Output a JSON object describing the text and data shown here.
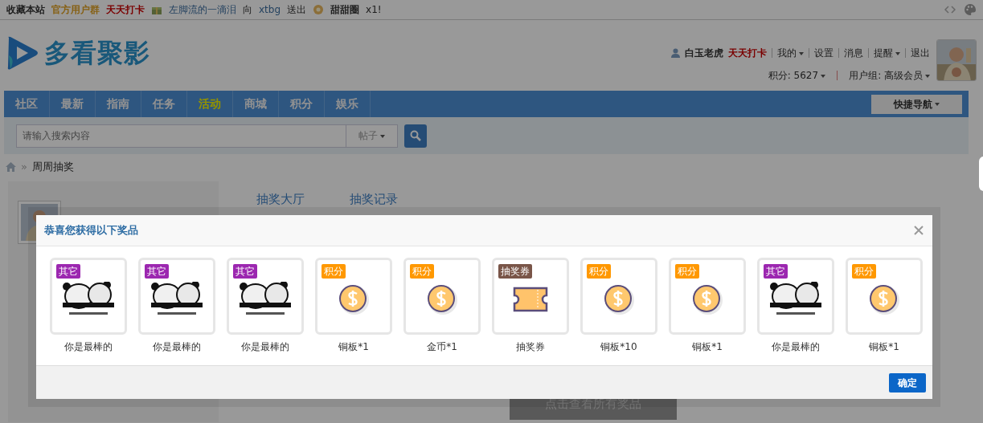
{
  "top_bar": {
    "links": [
      {
        "text": "收藏本站",
        "kind": "plain"
      },
      {
        "text": "官方用户群",
        "kind": "group"
      },
      {
        "text": "天天打卡",
        "kind": "checkin"
      }
    ],
    "notice": {
      "user": "左脚流的一滴泪",
      "verb": "向",
      "target": "xtbg",
      "action": "送出",
      "gift": "甜甜圈",
      "count": "x1!"
    }
  },
  "header": {
    "logo": "多看聚影",
    "user": {
      "name": "白玉老虎",
      "checkin": "天天打卡"
    },
    "menu": [
      {
        "label": "我的",
        "dropdown": true
      },
      {
        "label": "设置",
        "dropdown": false
      },
      {
        "label": "消息",
        "dropdown": false
      },
      {
        "label": "提醒",
        "dropdown": true
      },
      {
        "label": "退出",
        "dropdown": false
      }
    ],
    "stats": [
      {
        "label": "积分: 5627",
        "dropdown": true
      },
      {
        "label": "用户组: 高级会员",
        "dropdown": true
      }
    ]
  },
  "nav": {
    "items": [
      {
        "label": "社区",
        "selected": false
      },
      {
        "label": "最新",
        "selected": false
      },
      {
        "label": "指南",
        "selected": false
      },
      {
        "label": "任务",
        "selected": false
      },
      {
        "label": "活动",
        "selected": true
      },
      {
        "label": "商城",
        "selected": false
      },
      {
        "label": "积分",
        "selected": false
      },
      {
        "label": "娱乐",
        "selected": false
      }
    ],
    "quick_nav": "快捷导航"
  },
  "search": {
    "placeholder": "请输入搜索内容",
    "scope": "帖子"
  },
  "breadcrumb": {
    "separator": "»",
    "current": "周周抽奖"
  },
  "lottery_tabs": [
    "抽奖大厅",
    "抽奖记录"
  ],
  "view_all_button": "点击查看所有奖品",
  "modal": {
    "title": "恭喜您获得以下奖品",
    "prizes": [
      {
        "tag": "其它",
        "color": "#9c27b0",
        "kind": "picture",
        "label": "你是最棒的"
      },
      {
        "tag": "其它",
        "color": "#9c27b0",
        "kind": "picture",
        "label": "你是最棒的"
      },
      {
        "tag": "其它",
        "color": "#9c27b0",
        "kind": "picture",
        "label": "你是最棒的"
      },
      {
        "tag": "积分",
        "color": "#ff9800",
        "kind": "coin",
        "label": "铜板*1"
      },
      {
        "tag": "积分",
        "color": "#ff9800",
        "kind": "coin",
        "label": "金币*1"
      },
      {
        "tag": "抽奖券",
        "color": "#795548",
        "kind": "ticket",
        "label": "抽奖券"
      },
      {
        "tag": "积分",
        "color": "#ff9800",
        "kind": "coin",
        "label": "铜板*10"
      },
      {
        "tag": "积分",
        "color": "#ff9800",
        "kind": "coin",
        "label": "铜板*1"
      },
      {
        "tag": "其它",
        "color": "#9c27b0",
        "kind": "picture",
        "label": "你是最棒的"
      },
      {
        "tag": "积分",
        "color": "#ff9800",
        "kind": "coin",
        "label": "铜板*1"
      }
    ],
    "confirm": "确定"
  }
}
